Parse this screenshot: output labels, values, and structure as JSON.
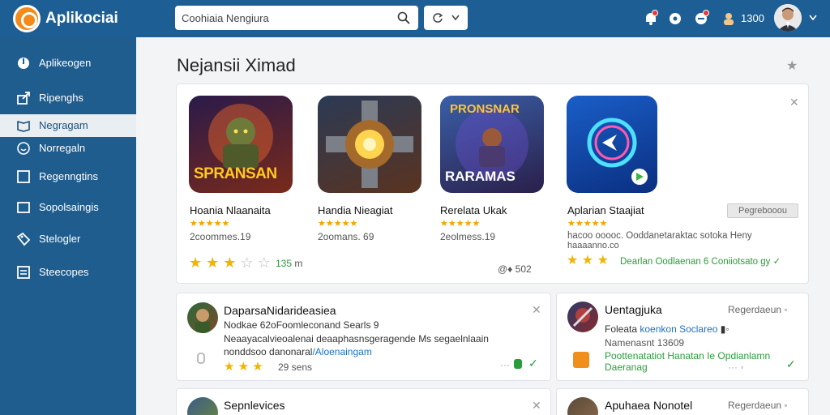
{
  "app": {
    "title": "Aplikociai",
    "accent": "#1d5f94",
    "logo_color": "#f28b1b"
  },
  "search": {
    "value": "Coohiaia Nengiura",
    "placeholder": "Coohiaia Nengiura"
  },
  "topbar": {
    "coins": "1300"
  },
  "sidebar": {
    "items": [
      {
        "label": "Aplikeogen",
        "icon": "power-icon"
      },
      {
        "label": "Ripenghs",
        "icon": "share-icon"
      },
      {
        "label": "Negragam",
        "icon": "book-icon"
      },
      {
        "label": "Norregaln",
        "icon": "face-icon"
      },
      {
        "label": "Regenngtins",
        "icon": "square-icon"
      },
      {
        "label": "Sopolsaingis",
        "icon": "window-icon"
      },
      {
        "label": "Stelogler",
        "icon": "tag-icon"
      },
      {
        "label": "Steecopes",
        "icon": "board-icon"
      }
    ]
  },
  "main": {
    "section_title": "Nejansii Ximad",
    "featured": [
      {
        "name": "Hoania Nlaanaita",
        "meta": "2coommes.19",
        "icon_text": "SPRANSAN",
        "rating": "135",
        "rating_label": "m"
      },
      {
        "name": "Handia Nieagiat",
        "meta": "2oomans. 69",
        "icon_text": ""
      },
      {
        "name": "Rerelata Ukak",
        "meta": "2eolmess.19",
        "icon_text": "RARAMAS",
        "icon_title": "PRONSNAR",
        "rating": "@♦ 502"
      },
      {
        "name": "Aplarian Staajiat",
        "meta": "hacoo ooooc. Ooddanetaraktac sotoka Heny",
        "meta2": "haaaanno.co",
        "green": "Dearlan Oodlaenan 6 Coniiotsato gy",
        "register": "Pegrebooou"
      }
    ],
    "cards": [
      {
        "title": "DaparsaNidarideasiea",
        "line1": "Nodkae 62oFoomleconand Searls 9",
        "line2": "Neaayacalvieoalenai deaaphasnsgeragende Ms segaelnlaain",
        "line3a": "nonddsoo danonaral",
        "line3b": "/Aloenaingam",
        "count": "29 sens"
      },
      {
        "title": "Uentagjuka",
        "reg": "Regerdaeun",
        "line1a": "Foleata",
        "line1b": "koenkon Soclareo",
        "line2": "Namenasnt 13609",
        "green1": "Poottenatatiot Hanatan Ie Opdianlamn",
        "green2": "Daeranag"
      },
      {
        "title": "Sepnlevices"
      },
      {
        "title": "Apuhaea Nonotel",
        "reg": "Regerdaeun"
      }
    ]
  }
}
